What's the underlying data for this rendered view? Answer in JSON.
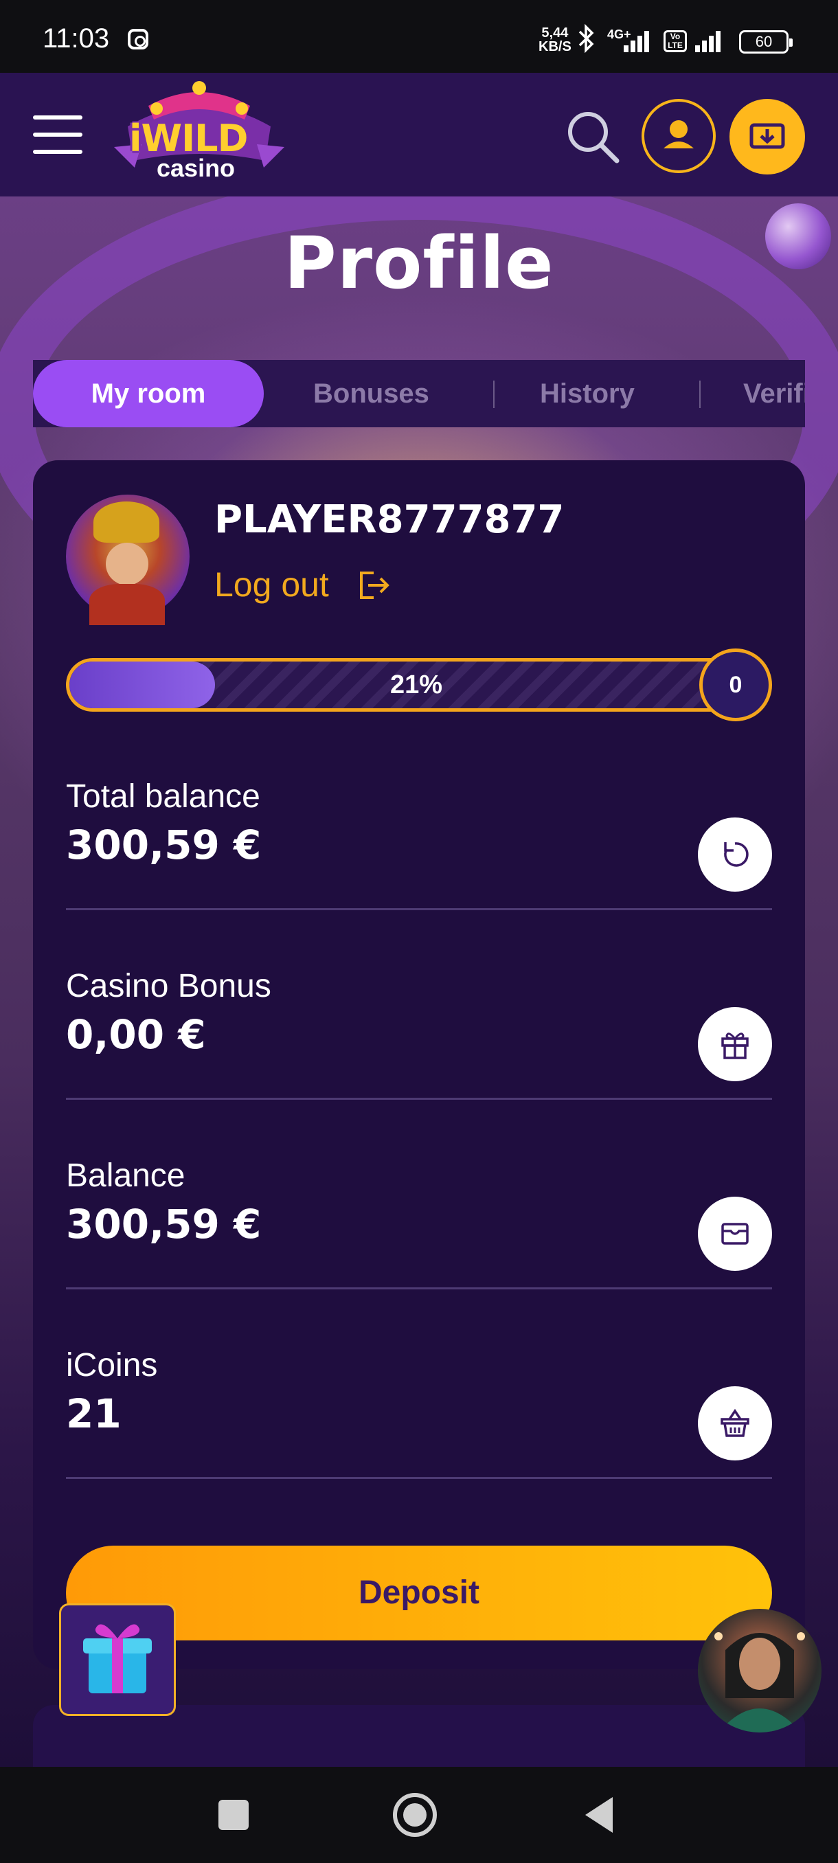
{
  "status_bar": {
    "time": "11:03",
    "speed_value": "5,44",
    "speed_unit": "KB/S",
    "network": "4G+",
    "battery": "60",
    "icons": [
      "instagram-icon",
      "bluetooth-icon",
      "signal-icon",
      "volte-icon",
      "signal-icon",
      "battery-icon"
    ]
  },
  "header": {
    "logo_word": "iWILD",
    "logo_sub": "casino",
    "icons": [
      "menu-icon",
      "search-icon",
      "user-icon",
      "cashier-icon"
    ],
    "accent": "#ffb81c"
  },
  "page": {
    "title": "Profile"
  },
  "tabs": [
    {
      "label": "My room",
      "active": true
    },
    {
      "label": "Bonuses",
      "active": false
    },
    {
      "label": "History",
      "active": false
    },
    {
      "label": "Verification",
      "active": false
    }
  ],
  "profile": {
    "username": "PLAYER8777877",
    "logout_label": "Log out",
    "progress_percent": 21,
    "progress_text": "21%",
    "level": "0"
  },
  "balances": [
    {
      "label": "Total balance",
      "value": "300,59 €",
      "icon": "refresh-icon"
    },
    {
      "label": "Casino Bonus",
      "value": "0,00 €",
      "icon": "gift-icon"
    },
    {
      "label": "Balance",
      "value": "300,59 €",
      "icon": "wallet-icon"
    },
    {
      "label": "iCoins",
      "value": "21",
      "icon": "basket-icon"
    }
  ],
  "actions": {
    "deposit_label": "Deposit"
  },
  "colors": {
    "primary": "#9a4df3",
    "accent": "#f4a51c",
    "card": "#1f0d3f",
    "text": "#ffffff"
  }
}
